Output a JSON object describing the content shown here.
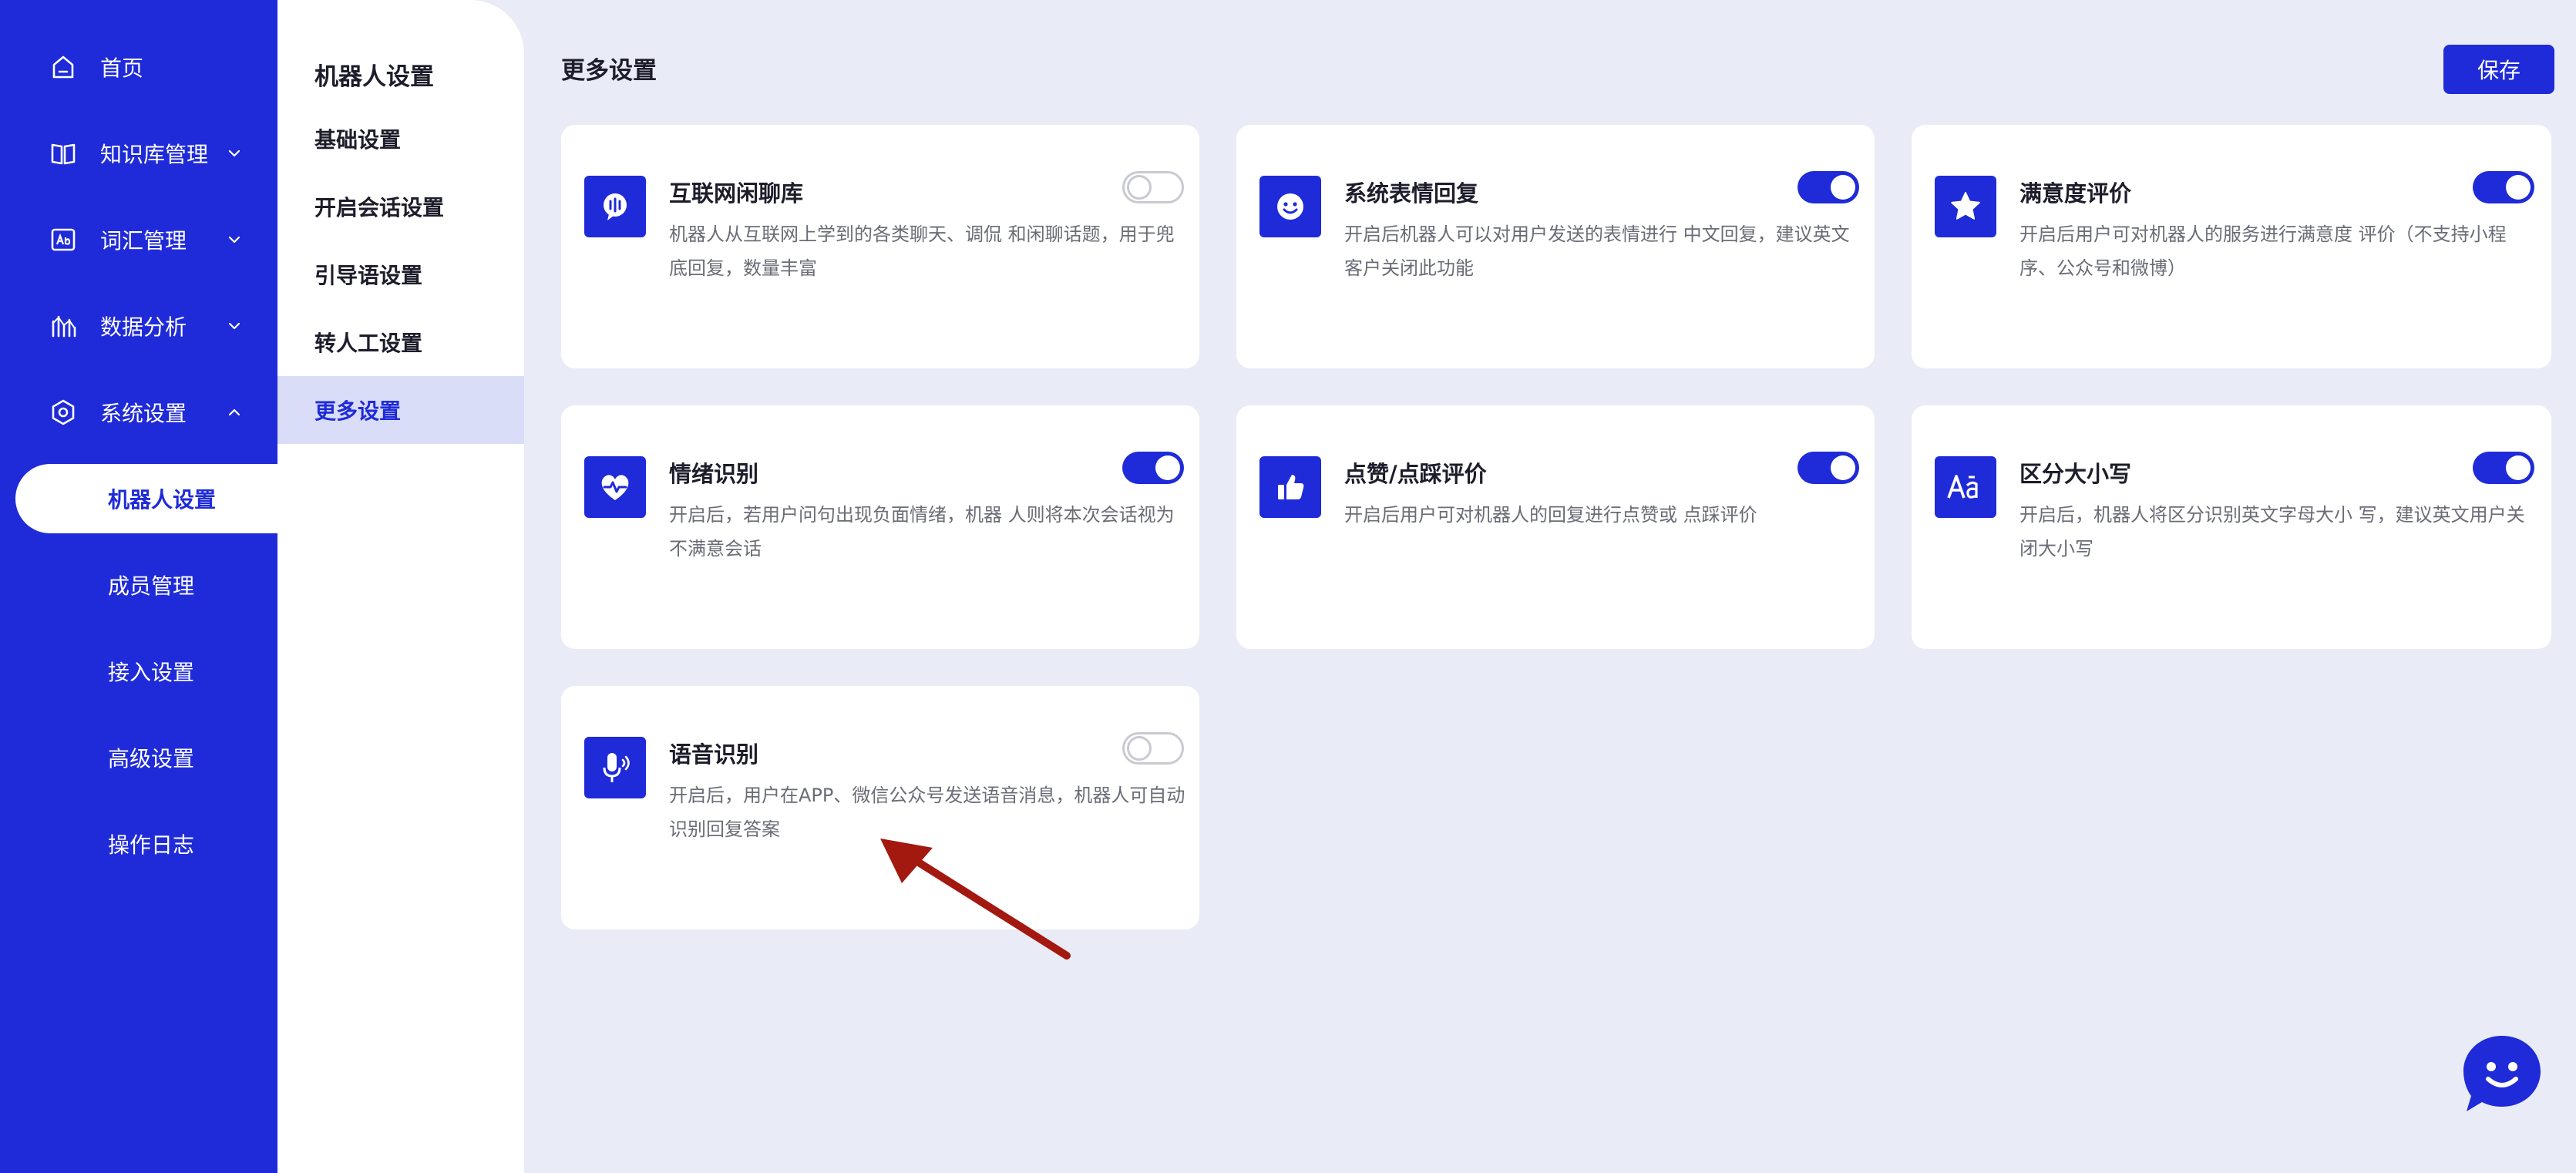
{
  "nav": {
    "items": [
      {
        "label": "首页",
        "icon": "home-icon"
      },
      {
        "label": "知识库管理",
        "icon": "book-icon"
      },
      {
        "label": "词汇管理",
        "icon": "vocabulary-icon"
      },
      {
        "label": "数据分析",
        "icon": "analytics-icon"
      },
      {
        "label": "系统设置",
        "icon": "settings-icon"
      }
    ],
    "sub_items": [
      {
        "label": "机器人设置"
      },
      {
        "label": "成员管理"
      },
      {
        "label": "接入设置"
      },
      {
        "label": "高级设置"
      },
      {
        "label": "操作日志"
      }
    ]
  },
  "menu": {
    "title": "机器人设置",
    "items": [
      {
        "label": "基础设置"
      },
      {
        "label": "开启会话设置"
      },
      {
        "label": "引导语设置"
      },
      {
        "label": "转人工设置"
      },
      {
        "label": "更多设置"
      }
    ]
  },
  "main": {
    "title": "更多设置",
    "save_label": "保存",
    "cards": [
      {
        "title": "互联网闲聊库",
        "desc": "机器人从互联网上学到的各类聊天、调侃 和闲聊话题，用于兜底回复，数量丰富",
        "enabled": false,
        "icon": "chat-bubble-icon"
      },
      {
        "title": "系统表情回复",
        "desc": "开启后机器人可以对用户发送的表情进行 中文回复，建议英文客户关闭此功能",
        "enabled": true,
        "icon": "smiley-icon"
      },
      {
        "title": "满意度评价",
        "desc": "开启后用户可对机器人的服务进行满意度 评价（不支持小程序、公众号和微博）",
        "enabled": true,
        "icon": "star-icon"
      },
      {
        "title": "情绪识别",
        "desc": "开启后，若用户问句出现负面情绪，机器 人则将本次会话视为不满意会话",
        "enabled": true,
        "icon": "heart-pulse-icon"
      },
      {
        "title": "点赞/点踩评价",
        "desc": "开启后用户可对机器人的回复进行点赞或 点踩评价",
        "enabled": true,
        "icon": "thumbs-up-icon"
      },
      {
        "title": "区分大小写",
        "desc": "开启后，机器人将区分识别英文字母大小 写，建议英文用户关闭大小写",
        "enabled": true,
        "icon": "letter-case-icon"
      },
      {
        "title": "语音识别",
        "desc": "开启后，用户在APP、微信公众号发送语音消息，机器人可自动识别回复答案",
        "enabled": false,
        "icon": "microphone-icon"
      }
    ]
  },
  "colors": {
    "primary": "#1f2bd8",
    "background": "#e9ecf6",
    "annotation_arrow": "#a3180f"
  }
}
